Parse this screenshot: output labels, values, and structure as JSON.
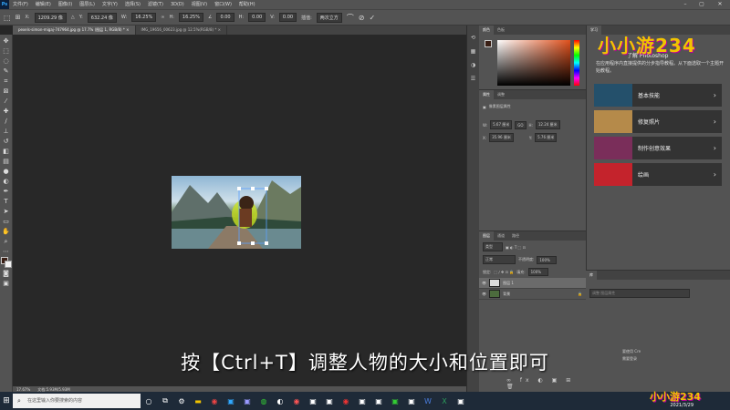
{
  "menubar": {
    "logo": "Ps",
    "items": [
      "文件(F)",
      "编辑(E)",
      "图像(I)",
      "图层(L)",
      "文字(Y)",
      "选择(S)",
      "滤镜(T)",
      "3D(D)",
      "视图(V)",
      "窗口(W)",
      "帮助(H)"
    ],
    "minimize": "–",
    "maximize": "▢",
    "close": "✕"
  },
  "options": {
    "x_label": "X:",
    "x_value": "1209.29 像",
    "y_label": "Y:",
    "y_value": "632.24 像",
    "w_label": "W:",
    "w_value": "16.25%",
    "h_label": "H:",
    "h_value": "16.25%",
    "angle_value": "0.00",
    "hskew_value": "0.00",
    "vskew_value": "0.00",
    "interp_label": "插值:",
    "interp_value": "两次立方"
  },
  "tabs": [
    {
      "label": "pexels-simon-migaj-747964.jpg @ 17.7% (图层 1, RGB/8) *",
      "close": "×"
    },
    {
      "label": "IMG_19656_00623.jpg @ 12.5%(RGB/8) *",
      "close": "×"
    }
  ],
  "status": {
    "zoom": "17.67%",
    "doc": "文档:5.93M/5.93M"
  },
  "color_panel": {
    "tabs": [
      "颜色",
      "色板"
    ],
    "fg_color": "#3a1f15",
    "bg_color": "#f2f2f2",
    "hue_color": "#e0501c"
  },
  "props_panel": {
    "tabs": [
      "属性",
      "调整"
    ],
    "section": "像素图层属性",
    "w_label": "W:",
    "w_value": "5.67 厘米",
    "link": "GO",
    "h_label": "H:",
    "h_value": "12.24 厘米",
    "x_label": "X:",
    "x_value": "35.96 厘米",
    "y_label": "Y:",
    "y_value": "5.76 厘米"
  },
  "layers_panel": {
    "tabs": [
      "图层",
      "通道",
      "路径"
    ],
    "search": "类型",
    "blend": "正常",
    "opacity_label": "不透明度:",
    "opacity_value": "100%",
    "lock_label": "锁定:",
    "fill_label": "填充:",
    "fill_value": "100%",
    "layers": [
      {
        "name": "图层 1",
        "selected": true
      },
      {
        "name": "背景",
        "selected": false
      }
    ]
  },
  "learn_panel": {
    "tab": "学习",
    "title": "了解 Photoshop",
    "desc": "在应用程序内直接提供的分步指导教程。从下面选取一个主题开始教程。",
    "cards": [
      {
        "label": "基本技能",
        "color": "#24506b"
      },
      {
        "label": "修复照片",
        "color": "#b58a4a"
      },
      {
        "label": "制作创意效果",
        "color": "#7a2e5a"
      },
      {
        "label": "绘画",
        "color": "#c4232c"
      }
    ]
  },
  "history_panel": {
    "search_hint": "调整 图层属性",
    "note1": "要使用 Cre",
    "note2": "需要登录"
  },
  "subtitle": "按【Ctrl+T】调整人物的大小和位置即可",
  "watermark": "小小游234",
  "taskbar": {
    "start": "⊞",
    "search_placeholder": "在这里输入你要搜索的内容",
    "time": "",
    "date": "2021/3/29"
  }
}
